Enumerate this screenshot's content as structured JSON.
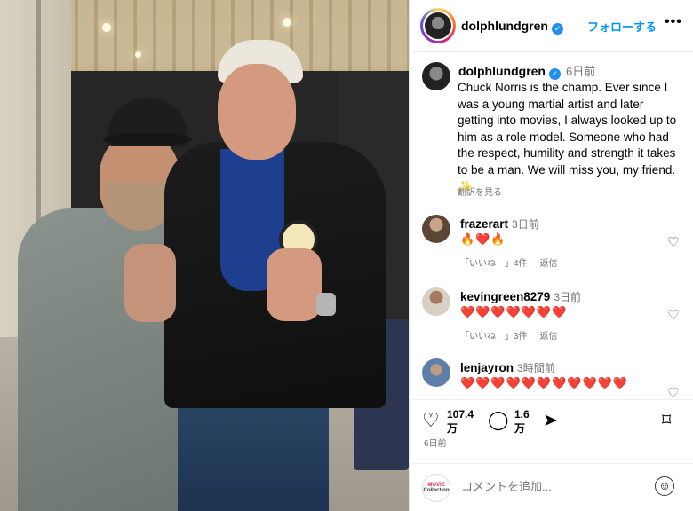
{
  "post": {
    "username": "dolphlundgren",
    "follow_label": "フォローする",
    "more_label": "•••",
    "caption_time": "6日前",
    "caption": "Chuck Norris is the champ. Ever since I was a young martial artist and later getting into movies, I always looked up to him as a role model. Someone who had the respect, humility and strength it takes to be a man. We will miss you, my friend. ✨",
    "translate_label": "翻訳を見る",
    "likes_count": "107.4万",
    "comments_count": "1.6万",
    "date": "6日前"
  },
  "comments": [
    {
      "user": "frazerart",
      "time": "3日前",
      "text": "🔥❤️🔥",
      "likes": "「いいね！」4件",
      "reply": "返信"
    },
    {
      "user": "kevingreen8279",
      "time": "3日前",
      "text": "❤️❤️❤️❤️❤️❤️❤️",
      "likes": "「いいね！」3件",
      "reply": "返信"
    },
    {
      "user": "lenjayron",
      "time": "3時間前",
      "text": "❤️❤️❤️❤️❤️❤️❤️❤️❤️❤️❤️",
      "likes": "",
      "reply": ""
    }
  ],
  "add_comment": {
    "placeholder": "コメントを追加...",
    "logo_top": "MOVIE",
    "logo_bottom": "Collection"
  },
  "icons": {
    "verified": "verified-check-icon",
    "heart": "heart-icon",
    "comment": "comment-bubble-icon",
    "share": "paper-plane-icon",
    "save": "bookmark-icon",
    "emoji": "smiley-icon"
  },
  "colors": {
    "accent": "#0095f6",
    "verified": "#1f8ef1",
    "muted": "#737373"
  }
}
